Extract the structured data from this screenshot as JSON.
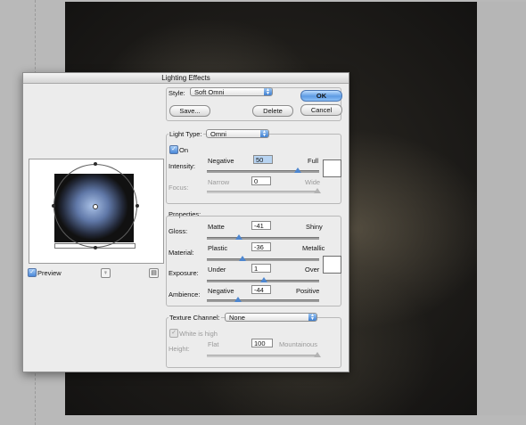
{
  "dialog": {
    "title": "Lighting Effects",
    "ok_label": "OK",
    "cancel_label": "Cancel",
    "save_label": "Save...",
    "delete_label": "Delete"
  },
  "style": {
    "label": "Style:",
    "value": "Soft Omni"
  },
  "light": {
    "type_label": "Light Type:",
    "type_value": "Omni",
    "on_label": "On",
    "on_checked": true,
    "intensity": {
      "label": "Intensity:",
      "left": "Negative",
      "right": "Full",
      "value": "50"
    },
    "focus": {
      "label": "Focus:",
      "left": "Narrow",
      "right": "Wide",
      "value": "0"
    }
  },
  "properties": {
    "title": "Properties:",
    "gloss": {
      "label": "Gloss:",
      "left": "Matte",
      "right": "Shiny",
      "value": "-41"
    },
    "material": {
      "label": "Material:",
      "left": "Plastic",
      "right": "Metallic",
      "value": "-36"
    },
    "exposure": {
      "label": "Exposure:",
      "left": "Under",
      "right": "Over",
      "value": "1"
    },
    "ambience": {
      "label": "Ambience:",
      "left": "Negative",
      "right": "Positive",
      "value": "-44"
    }
  },
  "texture": {
    "label": "Texture Channel:",
    "value": "None",
    "white_is_high": "White is high",
    "height": {
      "label": "Height:",
      "left": "Flat",
      "right": "Mountainous",
      "value": "100"
    }
  },
  "preview": {
    "label": "Preview",
    "checked": true
  },
  "icons": {
    "light_bulb": "light-bulb-icon",
    "trash": "trash-icon",
    "popup_arrows": "popup-arrows-icon",
    "check": "checkmark-icon"
  },
  "colors": {
    "accent": "#4d86cf",
    "dialog_bg": "#ececec",
    "canvas_bg": "#1e1c19"
  }
}
